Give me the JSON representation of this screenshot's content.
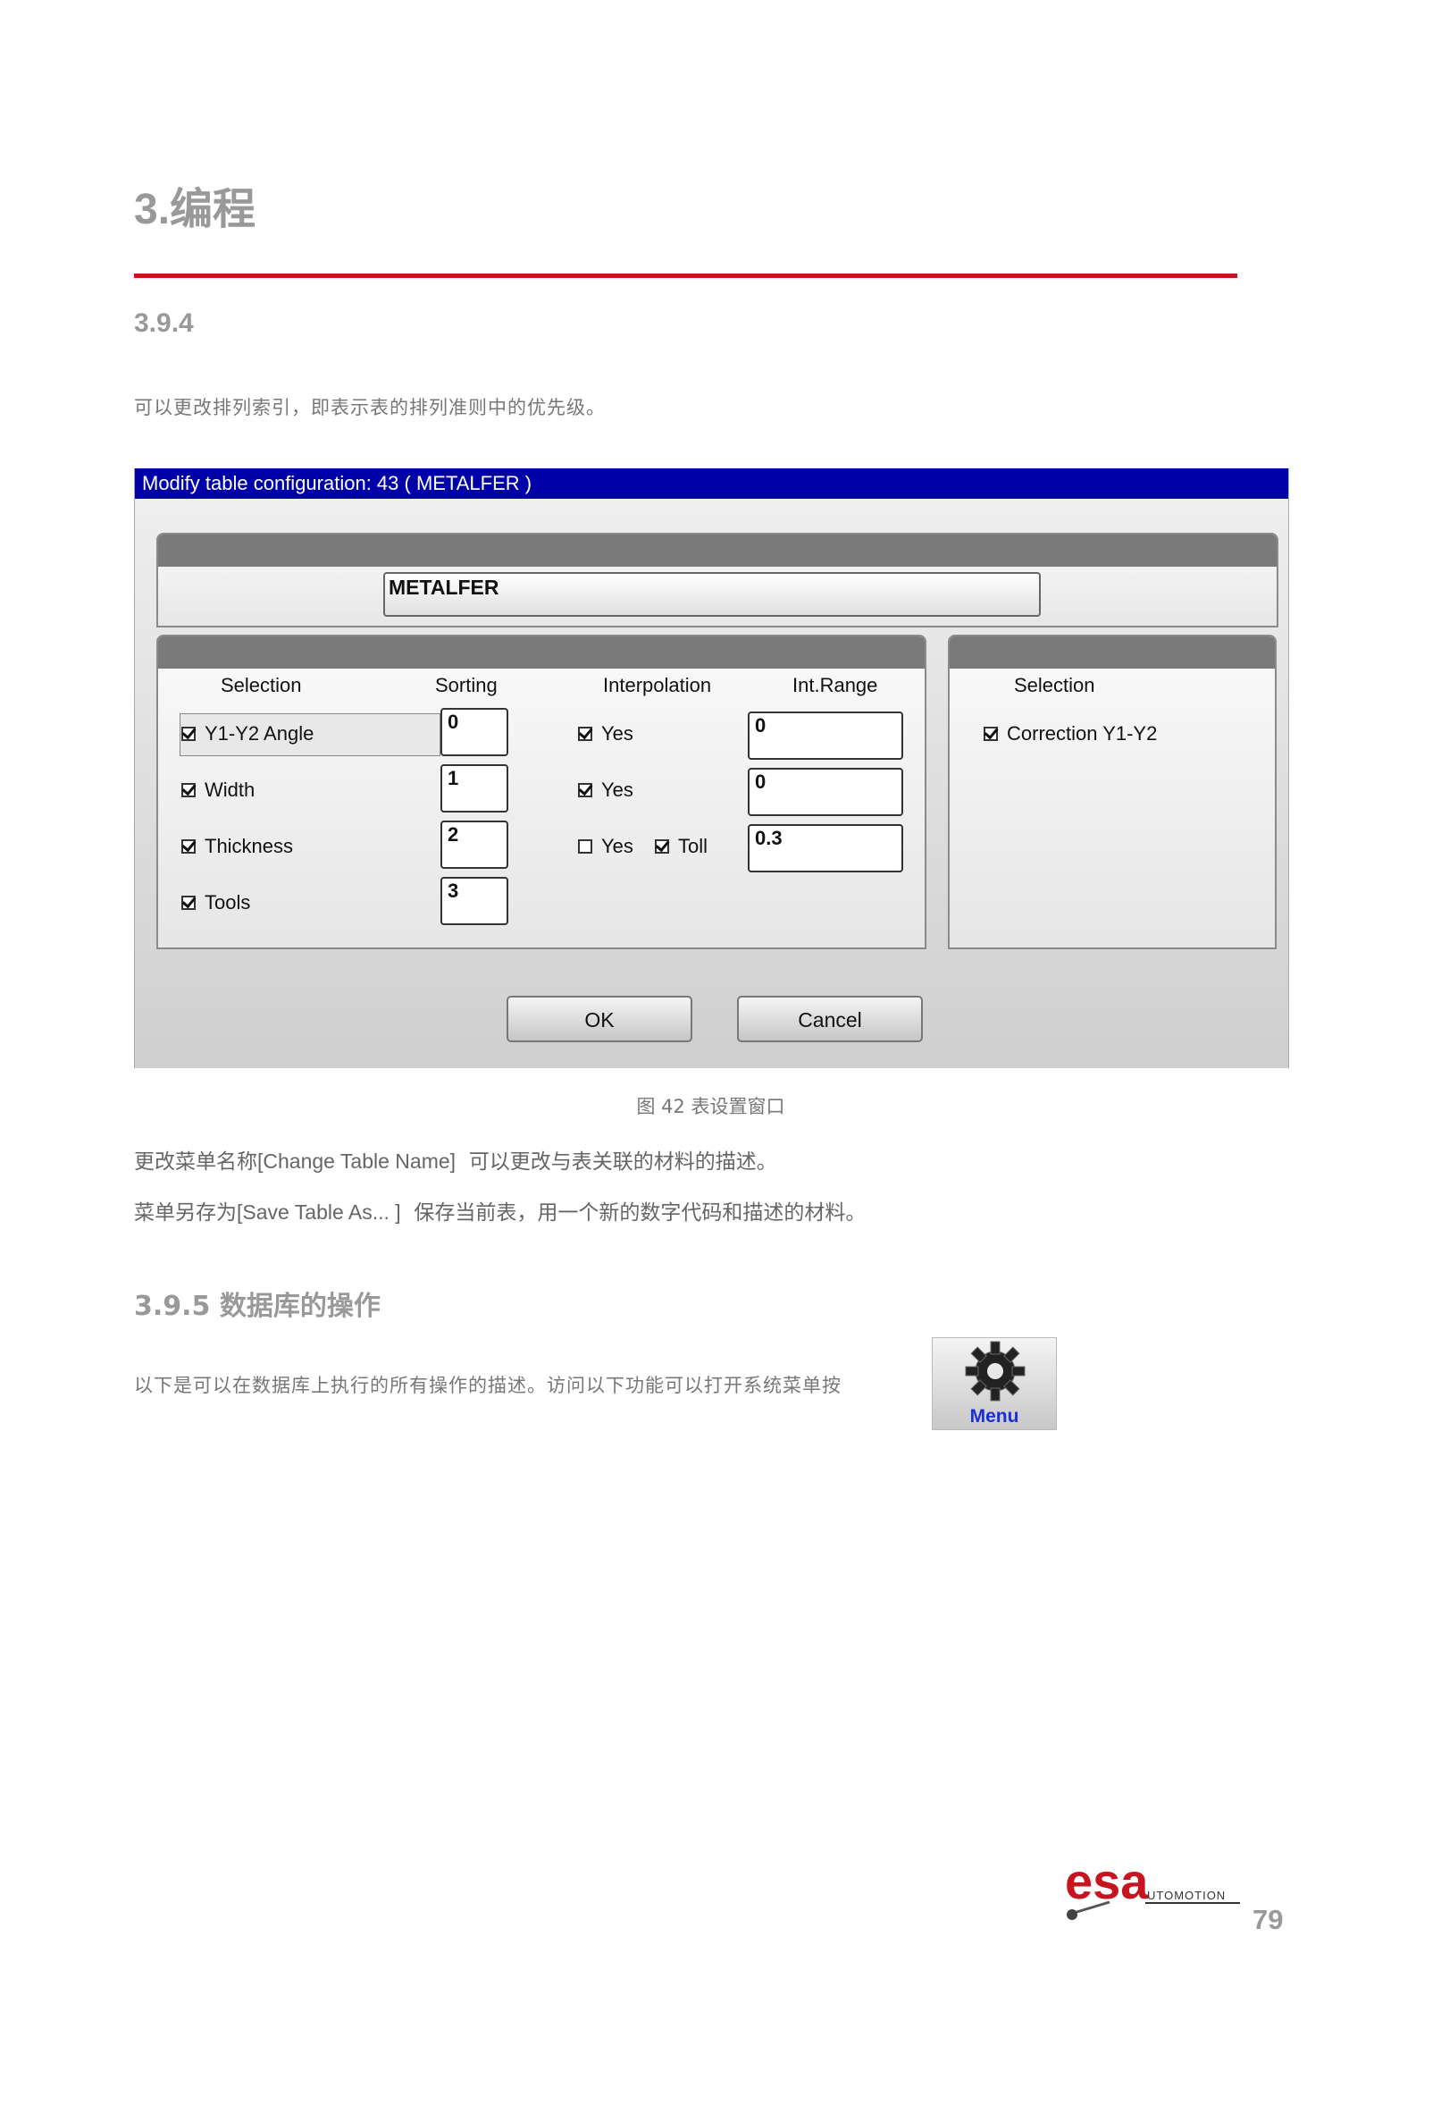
{
  "chapter": {
    "title": "3.编程"
  },
  "section_394": {
    "number": "3.9.4",
    "intro": "可以更改排列索引，即表示表的排列准则中的优先级。"
  },
  "dialog": {
    "title": "Modify table configuration: 43 ( METALFER )",
    "name_value": "METALFER",
    "headers": {
      "selection": "Selection",
      "sorting": "Sorting",
      "interpolation": "Interpolation",
      "int_range": "Int.Range",
      "right_selection": "Selection"
    },
    "rows": [
      {
        "label": "Y1-Y2 Angle",
        "checked": true,
        "sorting": "0",
        "interp_label": "Yes",
        "interp_checked": true,
        "range": "0"
      },
      {
        "label": "Width",
        "checked": true,
        "sorting": "1",
        "interp_label": "Yes",
        "interp_checked": true,
        "range": "0"
      },
      {
        "label": "Thickness",
        "checked": true,
        "sorting": "2",
        "interp_label": "Yes",
        "interp_checked": false,
        "toll_label": "Toll",
        "toll_checked": true,
        "range": "0.3"
      },
      {
        "label": "Tools",
        "checked": true,
        "sorting": "3"
      }
    ],
    "right": {
      "label": "Correction Y1-Y2",
      "checked": true
    },
    "buttons": {
      "ok": "OK",
      "cancel": "Cancel"
    }
  },
  "caption": "图 42 表设置窗口",
  "para_change": {
    "prefix": "更改菜单名称",
    "bracket": "[Change Table Name]",
    "text": "可以更改与表关联的材料的描述。"
  },
  "para_save": {
    "prefix": "菜单另存为",
    "bracket": "[Save Table As... ]",
    "text": "保存当前表，用一个新的数字代码和描述的材料。"
  },
  "section_395": {
    "title": "3.9.5 数据库的操作",
    "text": "以下是可以在数据库上执行的所有操作的描述。访问以下功能可以打开系统菜单按"
  },
  "menu_button": {
    "label": "Menu"
  },
  "footer": {
    "logo_main": "esa",
    "logo_sub": "UTOMOTION",
    "page_number": "79"
  },
  "colors": {
    "rule": "#c8141e",
    "titlebar": "#0000a8",
    "logo": "#c8141e",
    "menu_label": "#1a2fd6"
  }
}
